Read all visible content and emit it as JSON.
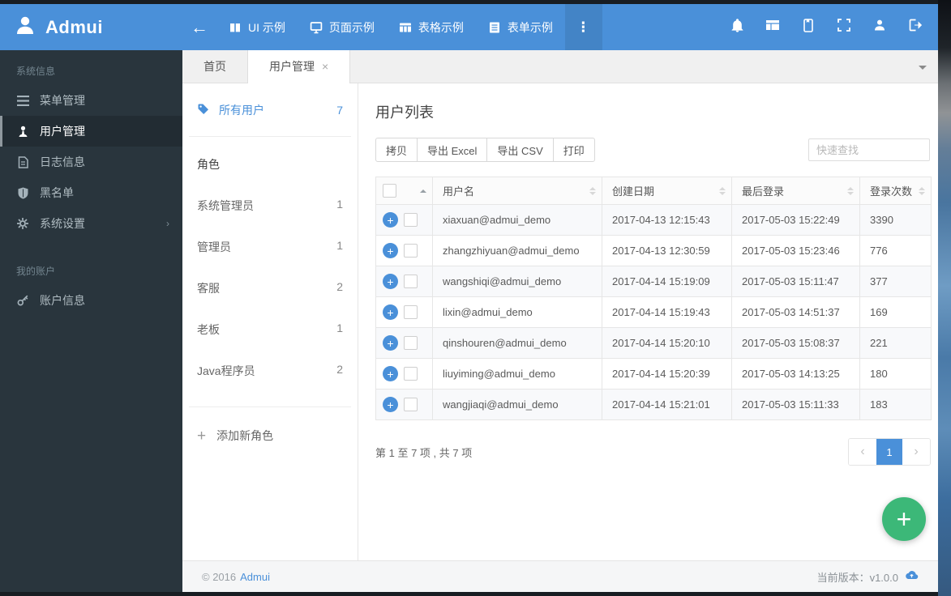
{
  "colors": {
    "accent": "#4a90d9",
    "fab_green": "#3cb878",
    "sidebar_bg": "#29353d"
  },
  "navbar": {
    "brand": "Admui",
    "back": "←",
    "items": [
      {
        "label": "UI 示例",
        "icon": "book-icon"
      },
      {
        "label": "页面示例",
        "icon": "monitor-icon"
      },
      {
        "label": "表格示例",
        "icon": "table-icon"
      },
      {
        "label": "表单示例",
        "icon": "form-icon"
      }
    ],
    "more": "⋮"
  },
  "sidebar": {
    "sections": [
      {
        "label": "系统信息",
        "items": [
          {
            "label": "菜单管理"
          },
          {
            "label": "用户管理",
            "active": true
          },
          {
            "label": "日志信息"
          },
          {
            "label": "黑名单"
          },
          {
            "label": "系统设置",
            "has_submenu": true,
            "chevron": "›"
          }
        ]
      },
      {
        "label": "我的账户",
        "items": [
          {
            "label": "账户信息"
          }
        ]
      }
    ]
  },
  "tabs": [
    {
      "label": "首页"
    },
    {
      "label": "用户管理",
      "active": true,
      "close": "×"
    }
  ],
  "panel": {
    "all_users_label": "所有用户",
    "all_users_count": "7",
    "roles_header": "角色",
    "roles": [
      {
        "name": "系统管理员",
        "count": "1"
      },
      {
        "name": "管理员",
        "count": "1"
      },
      {
        "name": "客服",
        "count": "2"
      },
      {
        "name": "老板",
        "count": "1"
      },
      {
        "name": "Java程序员",
        "count": "2"
      }
    ],
    "add_role_label": "添加新角色",
    "add_role_plus": "+"
  },
  "content": {
    "title": "用户列表",
    "toolbar": {
      "buttons": [
        "拷贝",
        "导出 Excel",
        "导出 CSV",
        "打印"
      ],
      "search_placeholder": "快速查找"
    },
    "table": {
      "columns": [
        "用户名",
        "创建日期",
        "最后登录",
        "登录次数"
      ],
      "rows": [
        {
          "username": "xiaxuan@admui_demo",
          "created": "2017-04-13 12:15:43",
          "last_login": "2017-05-03 15:22:49",
          "logins": "3390"
        },
        {
          "username": "zhangzhiyuan@admui_demo",
          "created": "2017-04-13 12:30:59",
          "last_login": "2017-05-03 15:23:46",
          "logins": "776"
        },
        {
          "username": "wangshiqi@admui_demo",
          "created": "2017-04-14 15:19:09",
          "last_login": "2017-05-03 15:11:47",
          "logins": "377"
        },
        {
          "username": "lixin@admui_demo",
          "created": "2017-04-14 15:19:43",
          "last_login": "2017-05-03 14:51:37",
          "logins": "169"
        },
        {
          "username": "qinshouren@admui_demo",
          "created": "2017-04-14 15:20:10",
          "last_login": "2017-05-03 15:08:37",
          "logins": "221"
        },
        {
          "username": "liuyiming@admui_demo",
          "created": "2017-04-14 15:20:39",
          "last_login": "2017-05-03 14:13:25",
          "logins": "180"
        },
        {
          "username": "wangjiaqi@admui_demo",
          "created": "2017-04-14 15:21:01",
          "last_login": "2017-05-03 15:11:33",
          "logins": "183"
        }
      ]
    },
    "info": "第 1 至 7 项 , 共 7 项",
    "pagination": {
      "prev": "‹",
      "current": "1",
      "next": "›"
    },
    "fab_plus": "+"
  },
  "footer": {
    "copyright": "© 2016",
    "brand_link": "Admui",
    "version": "当前版本：v1.0.0"
  }
}
